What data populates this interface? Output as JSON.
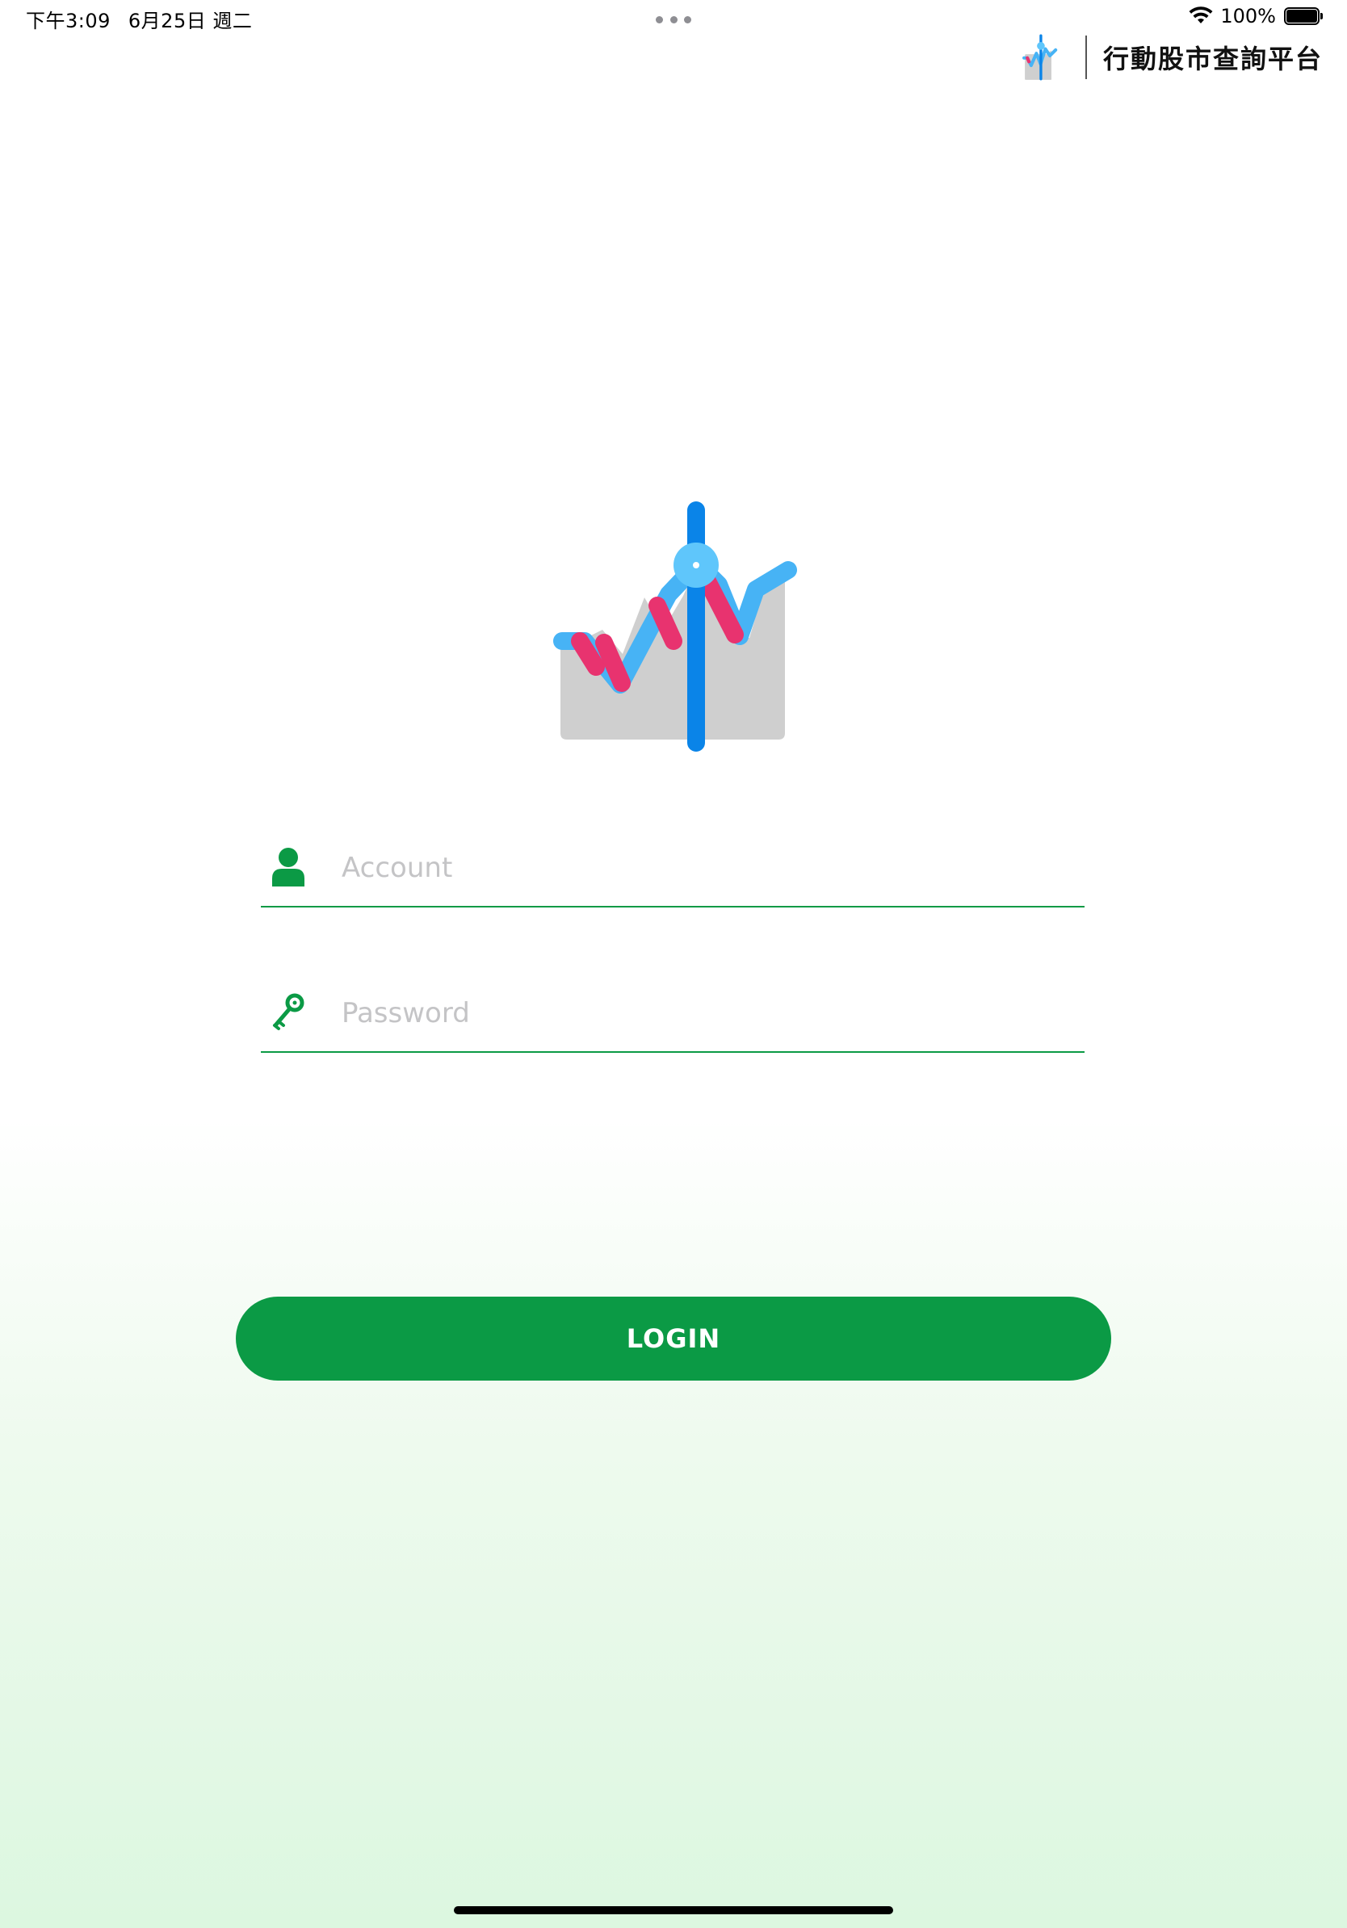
{
  "status_bar": {
    "time": "下午3:09",
    "date": "6月25日 週二",
    "battery_text": "100%",
    "battery_level": 1.0,
    "icons": [
      "wifi-icon",
      "battery-icon"
    ]
  },
  "brand": {
    "title": "行動股市查詢平台",
    "logo_icon": "stock-chart-logo-icon"
  },
  "login_form": {
    "account": {
      "placeholder": "Account",
      "value": "",
      "icon": "user-icon"
    },
    "password": {
      "placeholder": "Password",
      "value": "",
      "icon": "key-icon"
    },
    "login_label": "LOGIN"
  },
  "colors": {
    "accent": "#0b9a45",
    "logo_blue": "#47b3f5",
    "logo_pink": "#e8336f",
    "logo_bar": "#0a84e8",
    "logo_bg": "#cfcfcf",
    "background_bottom": "#dcf7e0"
  }
}
